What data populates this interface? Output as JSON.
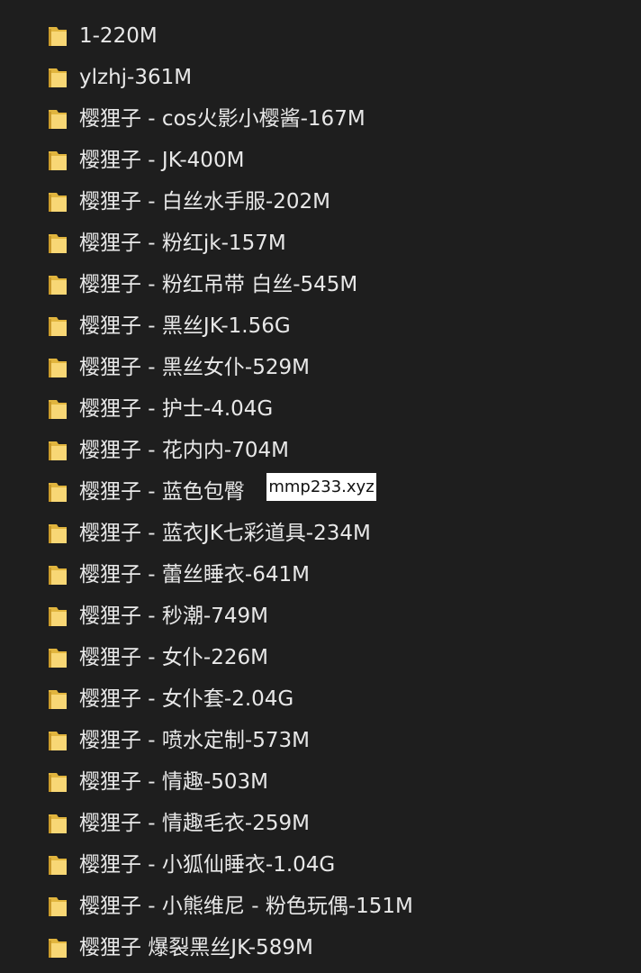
{
  "folders": [
    {
      "name": "1-220M"
    },
    {
      "name": "ylzhj-361M"
    },
    {
      "name": "樱狸子 - cos火影小樱酱-167M"
    },
    {
      "name": "樱狸子 - JK-400M"
    },
    {
      "name": "樱狸子 - 白丝水手服-202M"
    },
    {
      "name": "樱狸子 - 粉红jk-157M"
    },
    {
      "name": "樱狸子 - 粉红吊带 白丝-545M"
    },
    {
      "name": "樱狸子 - 黑丝JK-1.56G"
    },
    {
      "name": "樱狸子 - 黑丝女仆-529M"
    },
    {
      "name": "樱狸子 - 护士-4.04G"
    },
    {
      "name": "樱狸子 - 花内内-704M"
    },
    {
      "name": "樱狸子 - 蓝色包臀"
    },
    {
      "name": "樱狸子 - 蓝衣JK七彩道具-234M"
    },
    {
      "name": "樱狸子 - 蕾丝睡衣-641M"
    },
    {
      "name": "樱狸子 - 秒潮-749M"
    },
    {
      "name": "樱狸子 - 女仆-226M"
    },
    {
      "name": "樱狸子 - 女仆套-2.04G"
    },
    {
      "name": "樱狸子 - 喷水定制-573M"
    },
    {
      "name": "樱狸子 - 情趣-503M"
    },
    {
      "name": "樱狸子 - 情趣毛衣-259M"
    },
    {
      "name": "樱狸子 - 小狐仙睡衣-1.04G"
    },
    {
      "name": "樱狸子 - 小熊维尼 - 粉色玩偶-151M"
    },
    {
      "name": "樱狸子 爆裂黑丝JK-589M"
    }
  ],
  "icon": "folder-icon",
  "colors": {
    "background": "#1e1e1e",
    "text": "#e8e8e8",
    "folder_front": "#f8d775",
    "folder_back": "#e1b53e"
  },
  "watermark": {
    "text": "mmp233.xyz"
  }
}
